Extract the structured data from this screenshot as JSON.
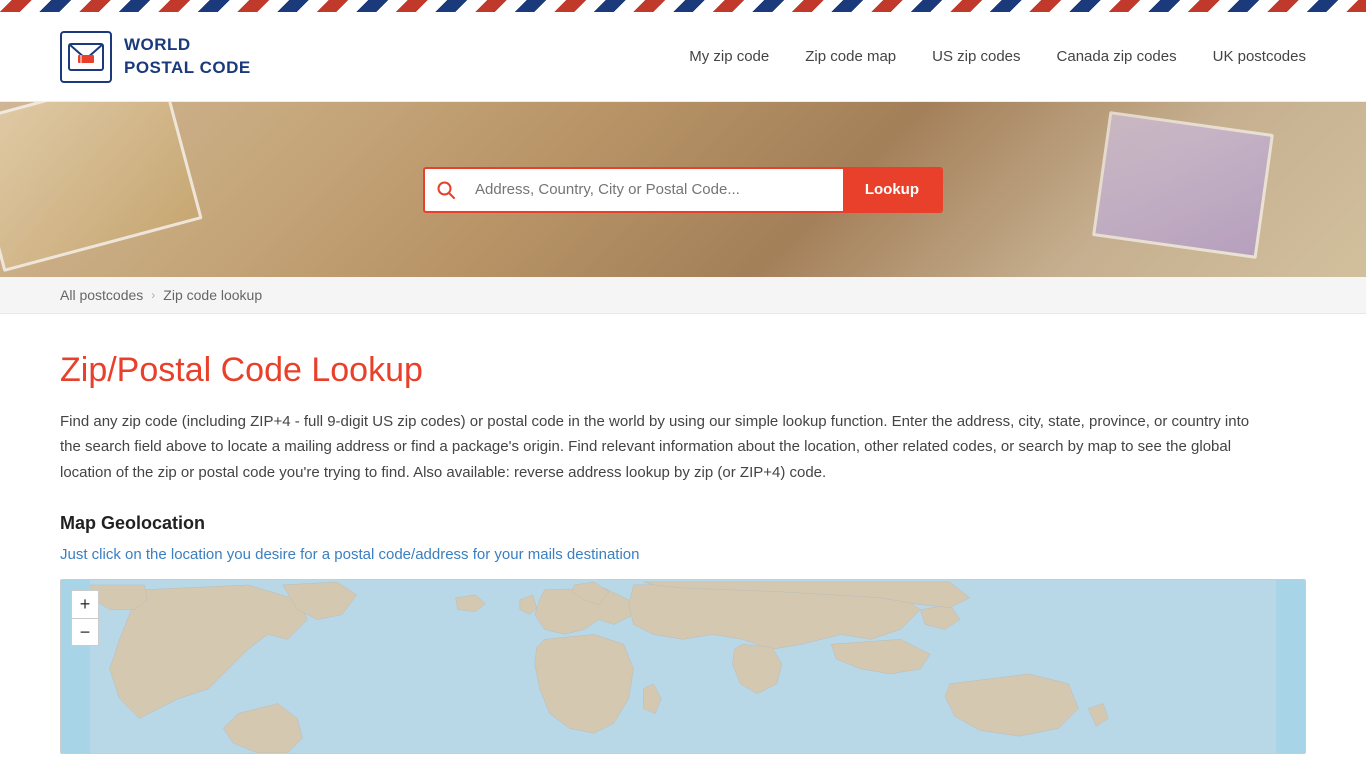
{
  "topStripe": {},
  "header": {
    "logo": {
      "line1": "WORLD",
      "line2": "POSTAL CODE"
    },
    "nav": [
      {
        "label": "My zip code",
        "href": "#"
      },
      {
        "label": "Zip code map",
        "href": "#"
      },
      {
        "label": "US zip codes",
        "href": "#"
      },
      {
        "label": "Canada zip codes",
        "href": "#"
      },
      {
        "label": "UK postcodes",
        "href": "#"
      }
    ]
  },
  "search": {
    "placeholder": "Address, Country, City or Postal Code...",
    "button_label": "Lookup"
  },
  "breadcrumb": {
    "items": [
      {
        "label": "All postcodes",
        "href": "#"
      },
      {
        "label": "Zip code lookup",
        "href": "#"
      }
    ]
  },
  "main": {
    "title_plain": "Zip/Postal Code ",
    "title_highlight": "Lookup",
    "description": "Find any zip code (including ZIP+4 - full 9-digit US zip codes) or postal code in the world by using our simple lookup function. Enter the address, city, state, province, or country into the search field above to locate a mailing address or find a package's origin. Find relevant information about the location, other related codes, or search by map to see the global location of the zip or postal code you're trying to find. Also available: reverse address lookup by zip (or ZIP+4) code.",
    "map_section_title": "Map Geolocation",
    "map_hint": "Just click on the location you desire for a postal code/address for your mails destination",
    "map_plus_label": "+",
    "map_minus_label": "−"
  }
}
